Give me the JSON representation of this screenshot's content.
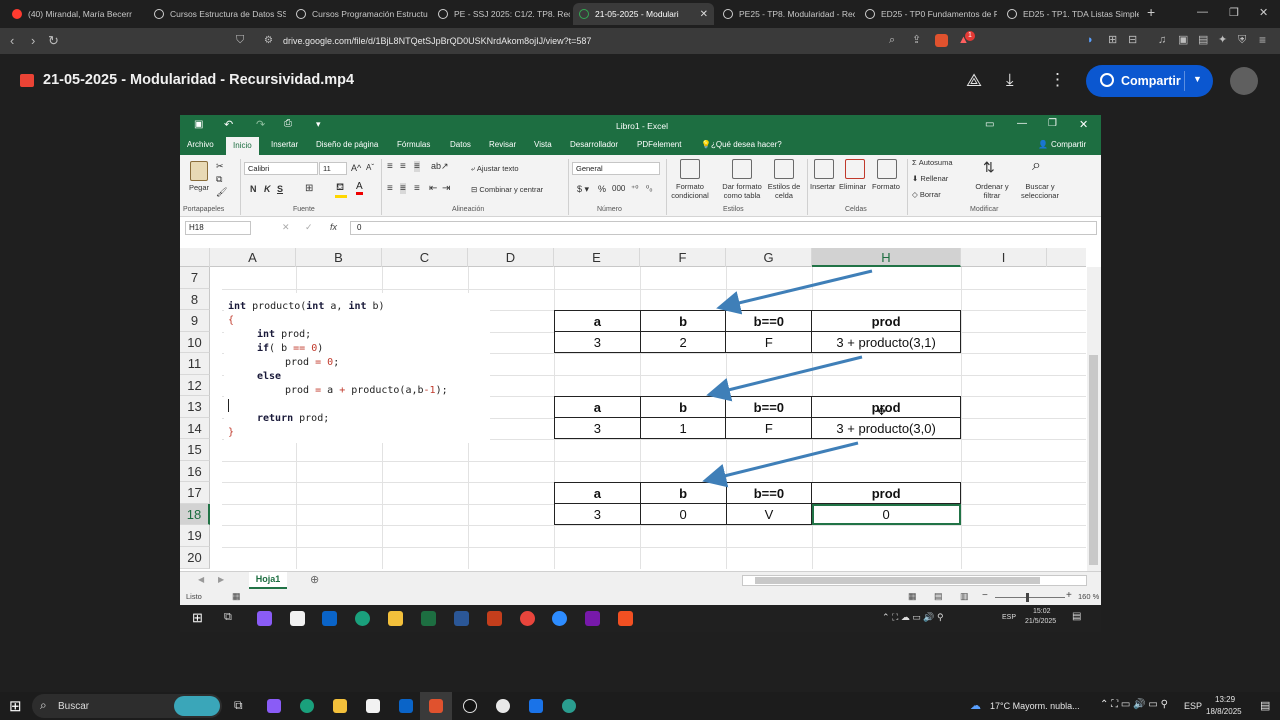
{
  "browser": {
    "tabs": [
      {
        "label": "(40) Mirandal, María Becerr",
        "color": "#ff3b30"
      },
      {
        "label": "Cursos Estructura de Datos SSJ",
        "color": "#cfcfcf"
      },
      {
        "label": "Cursos Programación Estructur",
        "color": "#cfcfcf"
      },
      {
        "label": "PE - SSJ 2025: C1/2. TP8. Recu",
        "color": "#cfcfcf"
      },
      {
        "label": "21-05-2025 - Modulari",
        "color": "#34a853"
      },
      {
        "label": "PE25 - TP8. Modularidad - Rec",
        "color": "#cfcfcf"
      },
      {
        "label": "ED25 - TP0 Fundamentos de P",
        "color": "#cfcfcf"
      },
      {
        "label": "ED25 - TP1. TDA Listas Simple",
        "color": "#cfcfcf"
      }
    ],
    "new_tab": "+",
    "close_glyph": "✕",
    "url": "drive.google.com/file/d/1BjL8NTQetSJpBrQD0USKNrdAkom8ojIJ/view?t=587",
    "notification_count": "1"
  },
  "viewer": {
    "title": "21-05-2025 - Modularidad - Recursividad.mp4",
    "share_label": "Compartir"
  },
  "excel": {
    "window_title": "Libro1 - Excel",
    "share_label": "Compartir",
    "tabs": [
      "Archivo",
      "Inicio",
      "Insertar",
      "Diseño de página",
      "Fórmulas",
      "Datos",
      "Revisar",
      "Vista",
      "Desarrollador",
      "PDFelement",
      "¿Qué desea hacer?"
    ],
    "ribbon": {
      "paste": "Pegar",
      "font_name": "Calibri",
      "font_size": "11",
      "bold": "N",
      "italic": "K",
      "underline": "S",
      "wrap_text": "Ajustar texto",
      "merge_center": "Combinar y centrar",
      "number_format": "General",
      "conditional": "Formato condicional",
      "as_table": "Dar formato como tabla",
      "cell_styles": "Estilos de celda",
      "insert": "Insertar",
      "delete": "Eliminar",
      "format": "Formato",
      "autosum": "Autosuma",
      "fill": "Rellenar",
      "clear": "Borrar",
      "sort_filter": "Ordenar y filtrar",
      "find_select": "Buscar y seleccionar",
      "groups": [
        "Portapapeles",
        "Fuente",
        "Alineación",
        "Número",
        "Estilos",
        "Celdas",
        "Modificar"
      ]
    },
    "name_box": "H18",
    "fx": "fx",
    "formula_value": "0",
    "columns": [
      "A",
      "B",
      "C",
      "D",
      "E",
      "F",
      "G",
      "H",
      "I"
    ],
    "rows": [
      "7",
      "8",
      "9",
      "10",
      "11",
      "12",
      "13",
      "14",
      "15",
      "16",
      "17",
      "18",
      "19",
      "20"
    ],
    "code_lines": [
      "int producto(int a, int b)",
      "{",
      "    int prod;",
      "    if( b == 0)",
      "        prod = 0;",
      "    else",
      "        prod = a + producto(a,b-1);",
      "",
      "    return prod;",
      "}"
    ],
    "tables": [
      {
        "headers": [
          "a",
          "b",
          "b==0",
          "prod"
        ],
        "values": [
          "3",
          "2",
          "F",
          "3 + producto(3,1)"
        ]
      },
      {
        "headers": [
          "a",
          "b",
          "b==0",
          "prod"
        ],
        "values": [
          "3",
          "1",
          "F",
          "3 + producto(3,0)"
        ]
      },
      {
        "headers": [
          "a",
          "b",
          "b==0",
          "prod"
        ],
        "values": [
          "3",
          "0",
          "V",
          "0"
        ]
      }
    ],
    "sheet_tab": "Hoja1",
    "status_text": "Listo",
    "zoom": "160 %",
    "inner_clock_time": "15:02",
    "inner_clock_date": "21/5/2025",
    "inner_lang": "ESP"
  },
  "taskbar": {
    "search": "Buscar",
    "weather": "17°C  Mayorm. nubla...",
    "lang": "ESP",
    "time": "13:29",
    "date": "18/8/2025"
  }
}
